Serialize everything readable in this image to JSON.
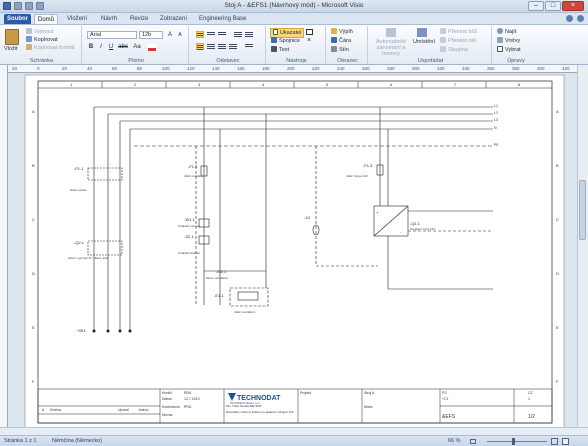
{
  "window": {
    "title": "Stoj A - &EFS1 (Návrhový mód) - Microsoft Visio",
    "minimize": "–",
    "maximize": "□",
    "close": "×"
  },
  "tabs": [
    "Soubor",
    "Domů",
    "Vložení",
    "Návrh",
    "Revize",
    "Zobrazení",
    "Engineering Base"
  ],
  "ribbon": {
    "clipboard": {
      "paste": "Vložit",
      "cut": "Vyjmout",
      "copy": "Kopírovat",
      "format": "Kopírovat formát",
      "label": "Schránka"
    },
    "font": {
      "family": "Arial",
      "size": "12b",
      "bold": "B",
      "italic": "I",
      "underline": "U",
      "strike": "abc",
      "aa": "Aa",
      "label": "Písmo",
      "grow": "A",
      "shrink": "A"
    },
    "paragraph": {
      "label": "Odstavec"
    },
    "tools": {
      "pointer": "Ukazatel",
      "connector": "Spojnice",
      "text": "Text",
      "label": "Nástroje"
    },
    "shape": {
      "fill": "Výplň",
      "line": "Čára",
      "shadow": "Stín",
      "label": "Obrazec"
    },
    "arrange": {
      "auto": "Automatické zarovnání a mezery",
      "position": "Umístění",
      "front": "Přenést blíž",
      "back": "Přenést dál",
      "group": "Skupina",
      "label": "Uspořádat"
    },
    "editing": {
      "find": "Najít",
      "layers": "Vrstvy",
      "select": "Vybrat",
      "label": "Úpravy"
    }
  },
  "ruler": {
    "h": [
      "20",
      "0",
      "20",
      "40",
      "60",
      "80",
      "100",
      "120",
      "140",
      "160",
      "180",
      "200",
      "220",
      "240",
      "260",
      "280",
      "300",
      "320",
      "340",
      "360",
      "380",
      "400",
      "420"
    ]
  },
  "drawing": {
    "cols": [
      "1",
      "2",
      "3",
      "4",
      "5",
      "6",
      "7",
      "8"
    ],
    "rows": [
      "A",
      "B",
      "C",
      "D",
      "E",
      "F"
    ],
    "bus": [
      "L1",
      "L2",
      "L3",
      "N",
      "PE"
    ],
    "components": {
      "f11": "-F1.1",
      "f11d": "Hlavní jističe",
      "q21": "-Q2.1",
      "q21d": "Hlavní vypínač 3f / Hlavní jistič",
      "f12": "-F1.2",
      "f12d": "Jistič ovládání",
      "w1": "-W1.1",
      "w1d": "Ovládací obvody",
      "s21": "-S2.1",
      "s21d": "Ovládací tlačítko",
      "m21": "-M2.1",
      "m21d": "Motor ventilátoru",
      "k1": "-K1",
      "k1d": "Stykač",
      "e11": "-E1.1",
      "e11d": "Jistič ventilátoru",
      "q11": "-Q1.1",
      "q11d": "Napájecí zdroj 24V",
      "f13": "-F1.3",
      "f13d": "Jistič zdroje 24V",
      "x1": "-X1",
      "xk1": "~XK1",
      "plus": "+",
      "minus": "-"
    },
    "titleblock": {
      "company": "TECHNODAT",
      "company_sub": "TECHNODAT Elektro, s.r.o.",
      "address": "Zlín, Třída Tomáše Bati 5267",
      "desc": "Rozvaděč s hlavním jističem a napájecím zdrojem 24V",
      "author": "Kreslil",
      "author_val": "RRA",
      "date_label": "Datum",
      "date_val": "12.7.2013",
      "checked": "Kontroloval",
      "checked_val": "PRU",
      "norm": "Norma",
      "project": "Projekt",
      "project_val": "Stroj A",
      "place": "Místo",
      "rev_label": "Revize",
      "rev_val": "A",
      "sheet_label": "List",
      "sheet_val": "1/2",
      "drawing_no": "&EFS",
      "site": "+C1",
      "ps": "PS",
      "cz": "CZ",
      "page": "1",
      "changes": "Změna",
      "modified": "Upravil",
      "name": "Jméno",
      "fmt": "Formát"
    }
  },
  "status": {
    "page": "Stránka 1 z 1",
    "lang": "Němčina (Německo)",
    "zoom": "66 %"
  },
  "colors": {
    "file_tab": "#2a5aa8",
    "highlight": "#f8d77a",
    "technodat": "#1f4e9a"
  }
}
